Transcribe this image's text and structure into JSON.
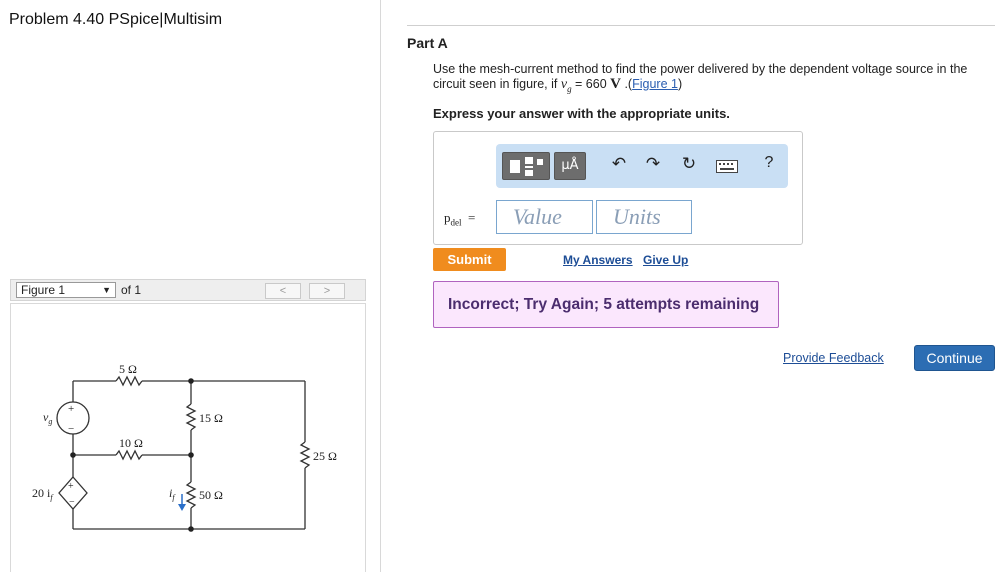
{
  "left_panel": {
    "title": "Problem 4.40 PSpice|Multisim",
    "figure_nav": {
      "selected": "Figure 1",
      "of_label": "of 1",
      "prev": "<",
      "next": ">"
    },
    "circuit": {
      "source_vg": "v",
      "source_vg_sub": "g",
      "dep_source_coef": "20 i",
      "dep_source_sub": "f",
      "current_label": "i",
      "current_sub": "f",
      "plus_vg": "+",
      "minus_vg": "−",
      "plus_dep": "+",
      "minus_dep": "−",
      "r1": "5 Ω",
      "r2": "15 Ω",
      "r3": "10 Ω",
      "r4": "25 Ω",
      "r5": "50 Ω"
    }
  },
  "part": {
    "title": "Part A",
    "prompt_text": "Use the mesh-current method to find the power delivered by the dependent voltage source in the circuit seen in figure, if ",
    "prompt_var": "v",
    "prompt_var_sub": "g",
    "prompt_eq": " = 660 ",
    "prompt_unit": "V",
    "prompt_after": " .(",
    "figure_link": "Figure 1",
    "prompt_close": ")",
    "express": "Express your answer with the appropriate units.",
    "toolbar": {
      "units_button": "μÅ",
      "help": "?"
    },
    "answer": {
      "label": "p",
      "label_sub": "del",
      "equals": "=",
      "value_placeholder": "Value",
      "units_placeholder": "Units"
    },
    "submit": "Submit",
    "my_answers": "My Answers",
    "give_up": "Give Up",
    "feedback_message": "Incorrect; Try Again; 5 attempts remaining"
  },
  "footer": {
    "provide_feedback": "Provide Feedback",
    "continue": "Continue"
  },
  "colors": {
    "submit": "#f08c1e",
    "continue": "#2c6db3",
    "incorrect_bg": "#fbe7fd",
    "incorrect_border": "#b063bf",
    "toolbar_bg": "#c9dff4"
  }
}
